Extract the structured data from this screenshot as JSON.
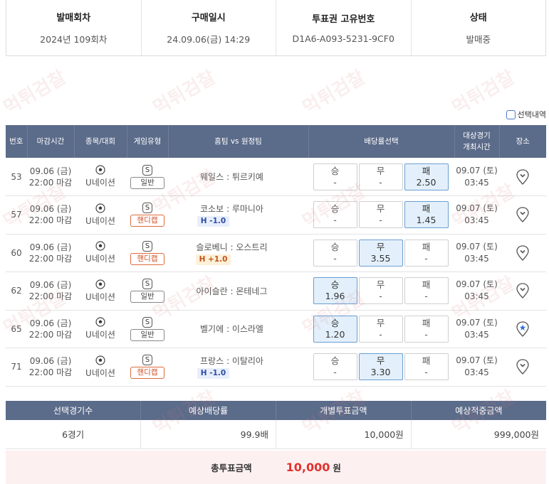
{
  "info": {
    "round_label": "발매회차",
    "round_value": "2024년 109회차",
    "purchase_label": "구매일시",
    "purchase_value": "24.09.06(금) 14:29",
    "ticket_label": "투표권 고유번호",
    "ticket_value": "D1A6-A093-5231-9CF0",
    "status_label": "상태",
    "status_value": "발매중"
  },
  "select_history": "선택내역",
  "table": {
    "headers": {
      "no": "번호",
      "deadline": "마감시간",
      "sport": "종목/대회",
      "gametype": "게임유형",
      "teams": "홈팀 vs 원정팀",
      "odds": "배당률선택",
      "date1": "대상경기",
      "date2": "개최시간",
      "venue": "장소"
    },
    "rows": [
      {
        "no": "53",
        "d1": "09.06 (금)",
        "d2": "22:00 마감",
        "sport": "U네이션",
        "gt_s": "S",
        "gt_t": "일반",
        "home": "웨일스",
        "away": "튀르키예",
        "handicap": "",
        "w": "승",
        "w_o": "-",
        "d": "무",
        "d_o": "-",
        "l": "패",
        "l_o": "2.50",
        "date1": "09.07 (토)",
        "date2": "03:45"
      },
      {
        "no": "57",
        "d1": "09.06 (금)",
        "d2": "22:00 마감",
        "sport": "U네이션",
        "gt_s": "S",
        "gt_t": "핸디캡",
        "home": "코소보",
        "away": "루마니아",
        "handicap": "H -1.0",
        "w": "승",
        "w_o": "-",
        "d": "무",
        "d_o": "-",
        "l": "패",
        "l_o": "1.45",
        "date1": "09.07 (토)",
        "date2": "03:45"
      },
      {
        "no": "60",
        "d1": "09.06 (금)",
        "d2": "22:00 마감",
        "sport": "U네이션",
        "gt_s": "S",
        "gt_t": "핸디캡",
        "home": "슬로베니",
        "away": "오스트리",
        "handicap": "H +1.0",
        "w": "승",
        "w_o": "-",
        "d": "무",
        "d_o": "3.55",
        "l": "패",
        "l_o": "-",
        "date1": "09.07 (토)",
        "date2": "03:45"
      },
      {
        "no": "62",
        "d1": "09.06 (금)",
        "d2": "22:00 마감",
        "sport": "U네이션",
        "gt_s": "S",
        "gt_t": "일반",
        "home": "아이슬란",
        "away": "몬테네그",
        "handicap": "",
        "w": "승",
        "w_o": "1.96",
        "d": "무",
        "d_o": "-",
        "l": "패",
        "l_o": "-",
        "date1": "09.07 (토)",
        "date2": "03:45"
      },
      {
        "no": "65",
        "d1": "09.06 (금)",
        "d2": "22:00 마감",
        "sport": "U네이션",
        "gt_s": "S",
        "gt_t": "일반",
        "home": "벨기에",
        "away": "이스라엘",
        "handicap": "",
        "w": "승",
        "w_o": "1.20",
        "d": "무",
        "d_o": "-",
        "l": "패",
        "l_o": "-",
        "date1": "09.07 (토)",
        "date2": "03:45"
      },
      {
        "no": "71",
        "d1": "09.06 (금)",
        "d2": "22:00 마감",
        "sport": "U네이션",
        "gt_s": "S",
        "gt_t": "핸디캡",
        "home": "프랑스",
        "away": "이탈리아",
        "handicap": "H -1.0",
        "w": "승",
        "w_o": "-",
        "d": "무",
        "d_o": "3.30",
        "l": "패",
        "l_o": "-",
        "date1": "09.07 (토)",
        "date2": "03:45"
      }
    ]
  },
  "summary": {
    "h1": "선택경기수",
    "h2": "예상배당률",
    "h3": "개별투표금액",
    "h4": "예상적중금액",
    "v1": "6경기",
    "v2": "99.9배",
    "v3": "10,000원",
    "v4": "999,000원"
  },
  "total": {
    "label": "총투표금액",
    "amount": "10,000",
    "unit": "원"
  },
  "watermark": "먹튀검찰",
  "colors": {
    "header_bg": "#5b6b8a",
    "selected_bg": "#e3f0fb",
    "total_bg": "#fdf0f0",
    "total_amount": "#e3322f"
  }
}
